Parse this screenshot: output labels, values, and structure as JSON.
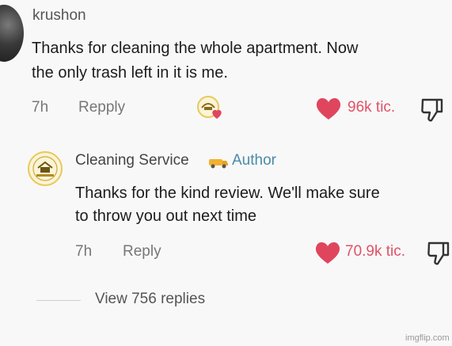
{
  "comment": {
    "username": "krushon",
    "text_line1": "Thanks for cleaning the whole apartment. Now",
    "text_line2": "the only trash left in it is me.",
    "time": "7h",
    "reply_label": "Repply",
    "likes": "96k tic."
  },
  "reply": {
    "username": "Cleaning Service",
    "author_label": "Author",
    "text_line1": "Thanks for the kind review. We'll make sure",
    "text_line2": "to throw you out next time",
    "time": "7h",
    "reply_label": "Reply",
    "likes": "70.9k tic."
  },
  "view_replies_label": "View 756 replies",
  "watermark": "imgflip.com",
  "colors": {
    "heart": "#e0455e",
    "author": "#4c8aa8",
    "logo_ring": "#e8c95b"
  },
  "icons": [
    "heart-icon",
    "dislike-icon",
    "creator-liked-icon",
    "van-emoji-icon"
  ]
}
